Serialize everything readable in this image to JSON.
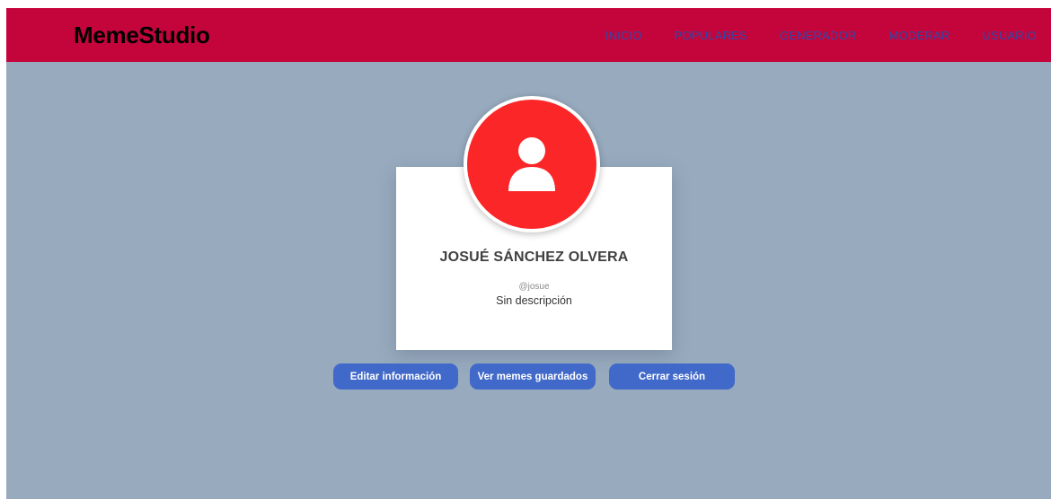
{
  "header": {
    "brand": "MemeStudio",
    "nav": [
      {
        "label": "INICIO"
      },
      {
        "label": "POPULARES"
      },
      {
        "label": "GENERADOR"
      },
      {
        "label": "MODERAR"
      },
      {
        "label": "USUARIO"
      }
    ]
  },
  "profile": {
    "avatar_icon": "user-icon",
    "full_name": "JOSUÉ SÁNCHEZ OLVERA",
    "username": "@josue",
    "description": "Sin descripción"
  },
  "actions": {
    "edit_label": "Editar información",
    "saved_label": "Ver memes guardados",
    "logout_label": "Cerrar sesión"
  },
  "colors": {
    "header_bg": "#c4053c",
    "page_bg": "#97aabe",
    "avatar_bg": "#fb2627",
    "button_bg": "#4169c9",
    "nav_link": "#3048a8"
  }
}
